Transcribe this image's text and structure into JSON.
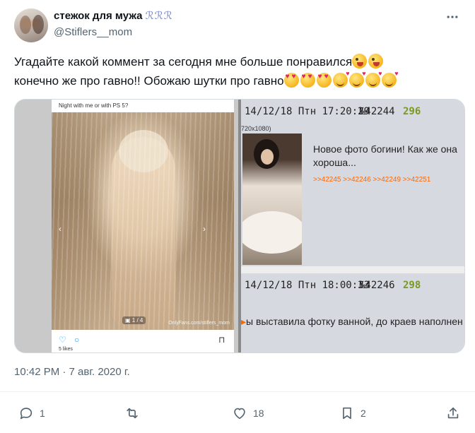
{
  "author": {
    "display_name": "стежок для мужа",
    "name_decoration": "ℛℛℛ",
    "handle": "@Stiflers__mom"
  },
  "tweet": {
    "line1": "Угадайте какой коммент за сегодня мне больше понравился",
    "line2": "конечно же про гавно!! Обожаю шутки про гавно",
    "timestamp": "10:42 PM · 7 авг. 2020 г."
  },
  "media": {
    "left": {
      "caption": "Night with me or with PS 5?",
      "photo_counter": "1 / 4",
      "watermark": "OnlyFans.com/stiflers_mom",
      "likes": "5 likes"
    },
    "right": {
      "post1": {
        "date": "14/12/18 Птн 17:20:29",
        "number": "№42244",
        "reply_count": "296",
        "resolution": "720x1080)",
        "text": "Новое фото богини! Как же она хороша...",
        "replies": ">>42245 >>42246 >>42249 >>42251"
      },
      "post2": {
        "date": "14/12/18 Птн 18:00:33",
        "number": "№42246",
        "reply_count": "298",
        "text": "ы выставила фотку ванной, до краев наполнен"
      }
    }
  },
  "actions": {
    "reply_count": "1",
    "retweet_count": "",
    "like_count": "18",
    "bookmark_count": "2"
  },
  "icons": [
    "more-icon",
    "reply-icon",
    "retweet-icon",
    "like-icon",
    "bookmark-icon",
    "share-icon",
    "heart-outline-icon",
    "comment-outline-icon",
    "bookmark-outline-icon"
  ],
  "colors": {
    "text": "#0f1419",
    "muted": "#536471",
    "link_orange": "#ff6600",
    "reply_green": "#789922",
    "twitter_blue": "#1d9bf0"
  }
}
